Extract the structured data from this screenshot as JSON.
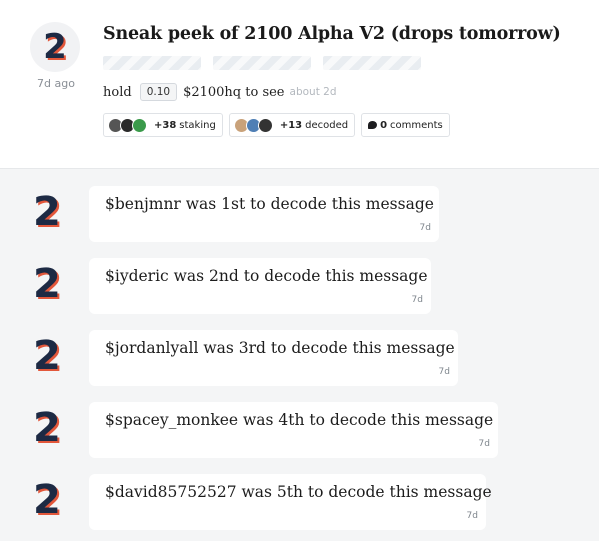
{
  "post": {
    "time": "7d ago",
    "title": "Sneak peek of 2100 Alpha V2 (drops tomorrow)",
    "hold_label": "hold",
    "hold_amount": "0.10",
    "hold_token_text": "$2100hq to see",
    "hold_time": "about 2d",
    "staking": {
      "count": "+38",
      "label": "staking"
    },
    "decoded": {
      "count": "+13",
      "label": "decoded"
    },
    "comments": {
      "count": "0",
      "label": "comments"
    },
    "logo_glyph": "2"
  },
  "feed": {
    "items": [
      {
        "user": "$benjmnr",
        "text": "was 1st to decode this message",
        "time": "7d",
        "logo_glyph": "2"
      },
      {
        "user": "$iyderic",
        "text": "was 2nd to decode this message",
        "time": "7d",
        "logo_glyph": "2"
      },
      {
        "user": "$jordanlyall",
        "text": "was 3rd to decode this message",
        "time": "7d",
        "logo_glyph": "2"
      },
      {
        "user": "$spacey_monkee",
        "text": "was 4th to decode this message",
        "time": "7d",
        "logo_glyph": "2"
      },
      {
        "user": "$david85752527",
        "text": "was 5th to decode this message",
        "time": "7d",
        "logo_glyph": "2"
      }
    ]
  },
  "colors": {
    "logo_front": "#1d2a44",
    "logo_back": "#e2573b",
    "feed_background": "#f4f5f6"
  }
}
